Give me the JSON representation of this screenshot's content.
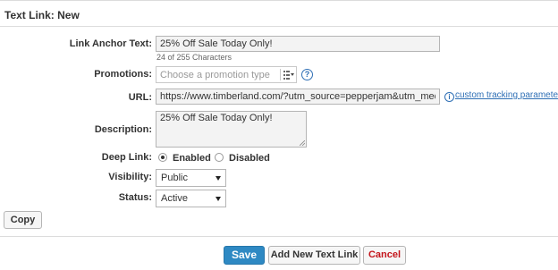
{
  "header": {
    "title": "Text Link: New"
  },
  "form": {
    "anchor_text": {
      "label": "Link Anchor Text:",
      "value": "25% Off Sale Today Only!",
      "char_count": "24 of 255 Characters"
    },
    "promotions": {
      "label": "Promotions:",
      "placeholder": "Choose a promotion type",
      "help_symbol": "?"
    },
    "url": {
      "label": "URL:",
      "value": "https://www.timberland.com/?utm_source=pepperjam&utm_medium=affiliate",
      "info_symbol": "i",
      "tracking_link": "custom tracking parameters"
    },
    "description": {
      "label": "Description:",
      "value": "25% Off Sale Today Only!"
    },
    "deep_link": {
      "label": "Deep Link:",
      "options": [
        "Enabled",
        "Disabled"
      ],
      "selected": "Enabled"
    },
    "visibility": {
      "label": "Visibility:",
      "value": "Public"
    },
    "status": {
      "label": "Status:",
      "value": "Active"
    }
  },
  "buttons": {
    "copy": "Copy",
    "save": "Save",
    "add_new": "Add New Text Link",
    "cancel": "Cancel"
  },
  "colors": {
    "accent": "#2e89c3",
    "link": "#2e6fb5",
    "danger": "#c4161c"
  }
}
